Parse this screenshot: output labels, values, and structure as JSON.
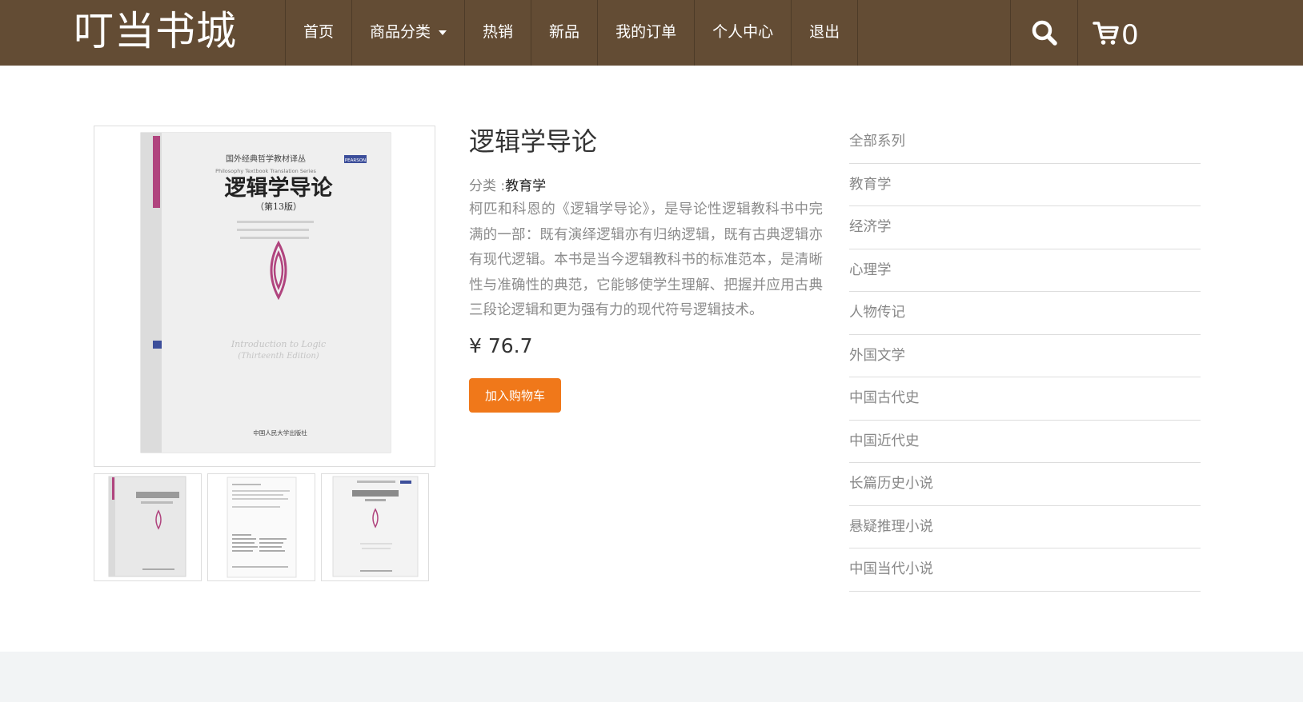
{
  "header": {
    "brand": "叮当书城",
    "nav": {
      "home": "首页",
      "categories": "商品分类",
      "hot": "热销",
      "new": "新品",
      "orders": "我的订单",
      "profile": "个人中心",
      "logout": "退出"
    },
    "search_icon": "search-icon",
    "cart_icon": "cart-icon",
    "cart_count": "0"
  },
  "product": {
    "title": "逻辑学导论",
    "category_label": "分类 :",
    "category_value": "教育学",
    "description": "柯匹和科恩的《逻辑学导论》，是导论性逻辑教科书中完满的一部：既有演绎逻辑亦有归纳逻辑，既有古典逻辑亦有现代逻辑。本书是当今逻辑教科书的标准范本，是清晰性与准确性的典范，它能够使学生理解、把握并应用古典三段论逻辑和更为强有力的现代符号逻辑技术。",
    "price": "¥ 76.7",
    "add_to_cart": "加入购物车",
    "cover": {
      "series": "国外经典哲学教材译丛",
      "series_en": "Philosophy Textbook Translation Series",
      "publisher_badge": "PEARSON",
      "title": "逻辑学导论",
      "edition": "（第13版）",
      "title_en": "Introduction to Logic",
      "edition_en": "(Thirteenth Edition)",
      "publisher": "中国人民大学出版社"
    }
  },
  "sidebar": {
    "categories": [
      "全部系列",
      "教育学",
      "经济学",
      "心理学",
      "人物传记",
      "外国文学",
      "中国古代史",
      "中国近代史",
      "长篇历史小说",
      "悬疑推理小说",
      "中国当代小说"
    ]
  },
  "colors": {
    "header_bg": "#634c34",
    "button_bg": "#f0781a",
    "cover_accent": "#b0447e",
    "footer_bg": "#f2f4f5"
  }
}
